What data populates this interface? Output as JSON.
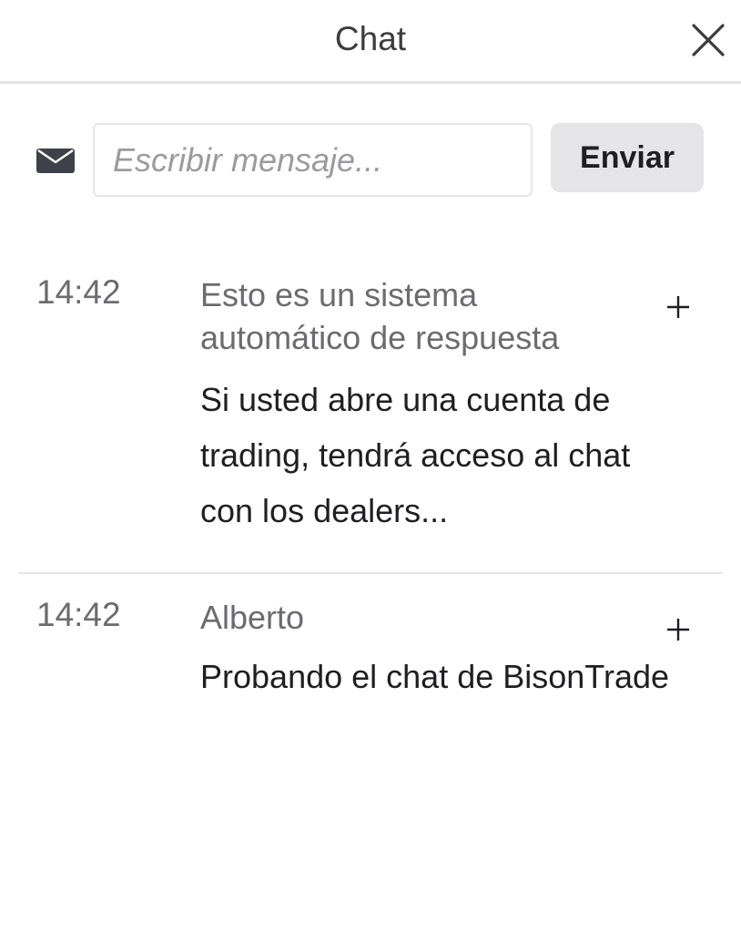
{
  "header": {
    "title": "Chat",
    "close_icon": "close-icon"
  },
  "compose": {
    "icon": "mail-icon",
    "placeholder": "Escribir mensaje...",
    "value": "",
    "send_label": "Enviar"
  },
  "messages": [
    {
      "time": "14:42",
      "sender": "Esto es un sistema automático de respuesta",
      "text": "Si usted abre una cuenta de trading, tendrá acceso al chat con los dealers...",
      "action_icon": "plus-icon"
    },
    {
      "time": "14:42",
      "sender": "Alberto",
      "text": "Probando el chat de BisonTrade",
      "action_icon": "plus-icon"
    }
  ],
  "colors": {
    "text_primary": "#1f1f23",
    "text_secondary": "#6b6b70",
    "button_bg": "#e5e5e8",
    "divider": "#e6e6e8"
  }
}
